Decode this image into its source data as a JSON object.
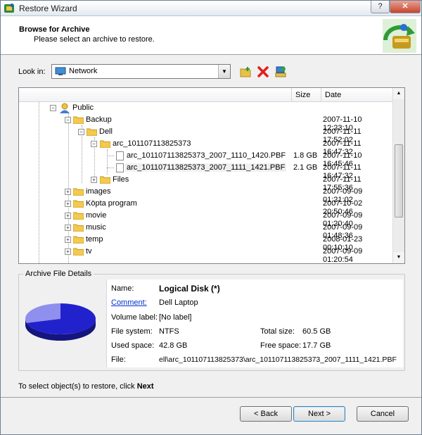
{
  "window": {
    "title": "Restore Wizard",
    "help_label": "?",
    "close_label": "✕"
  },
  "header": {
    "title": "Browse for Archive",
    "subtitle": "Please select an archive to restore."
  },
  "lookin": {
    "label": "Look in:",
    "value": "Network"
  },
  "columns": {
    "name": "",
    "size": "Size",
    "date": "Date"
  },
  "tree": {
    "public": {
      "label": "Public"
    },
    "backup": {
      "label": "Backup",
      "date": "2007-11-10 12:23:10"
    },
    "dell": {
      "label": "Dell",
      "date": "2007-11-11 17:52:02"
    },
    "arc": {
      "label": "arc_101107113825373",
      "date": "2007-11-11 16:47:32"
    },
    "file1": {
      "label": "arc_101107113825373_2007_1110_1420.PBF",
      "size": "1.8 GB",
      "date": "2007-11-10 16:45:46"
    },
    "file2": {
      "label": "arc_101107113825373_2007_1111_1421.PBF",
      "size": "2.1 GB",
      "date": "2007-11-11 16:47:32"
    },
    "files": {
      "label": "Files",
      "date": "2007-11-11 17:55:36"
    },
    "images": {
      "label": "images",
      "date": "2007-09-09 01:21:02"
    },
    "kopta": {
      "label": "Köpta program",
      "date": "2007-10-02 20:50:46"
    },
    "movie": {
      "label": "movie",
      "date": "2007-09-09 01:20:40"
    },
    "music": {
      "label": "music",
      "date": "2007-09-09 01:48:36"
    },
    "temp": {
      "label": "temp",
      "date": "2008-01-23 00:10:10"
    },
    "tv": {
      "label": "tv",
      "date": "2007-09-09 01:20:54"
    }
  },
  "details": {
    "group_title": "Archive File Details",
    "name_label": "Name:",
    "name_value": "Logical Disk (*)",
    "comment_label": "Comment:",
    "comment_value": "Dell Laptop",
    "volume_label": "Volume label:",
    "volume_value": "[No label]",
    "fs_label": "File system:",
    "fs_value": "NTFS",
    "total_label": "Total size:",
    "total_value": "60.5 GB",
    "used_label": "Used space:",
    "used_value": "42.8 GB",
    "free_label": "Free space:",
    "free_value": "17.7 GB",
    "file_label": "File:",
    "file_value": "ell\\arc_101107113825373\\arc_101107113825373_2007_1111_1421.PBF",
    "used_fraction": 0.707
  },
  "hint": {
    "text": "To select object(s) to restore, click",
    "action": "Next"
  },
  "buttons": {
    "back": "< Back",
    "next": "Next >",
    "cancel": "Cancel"
  },
  "colors": {
    "pie_used": "#2222cc",
    "pie_free": "#8f8fee",
    "link": "#0033cc"
  }
}
